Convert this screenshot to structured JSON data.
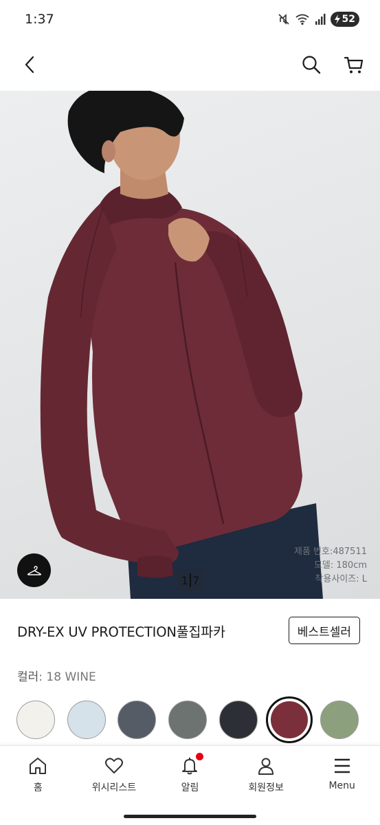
{
  "status": {
    "time": "1:37",
    "battery": "52"
  },
  "header": {
    "back_icon": "chevron-left-icon",
    "search_icon": "search-icon",
    "cart_icon": "cart-icon"
  },
  "hero": {
    "pager_current": "1",
    "pager_total": "7",
    "model_info": [
      {
        "label": "제품 번호",
        "value": "487511"
      },
      {
        "label": "모델",
        "value": "180cm"
      },
      {
        "label": "착용사이즈",
        "value": "L"
      }
    ]
  },
  "product": {
    "title": "DRY-EX UV PROTECTION풀집파카",
    "badge": "베스트셀러",
    "color_label": "컬러",
    "color_value": "18 WINE"
  },
  "swatches": [
    {
      "color": "#f3f1ec",
      "selected": false
    },
    {
      "color": "#d6e2ea",
      "selected": false
    },
    {
      "color": "#555c66",
      "selected": false
    },
    {
      "color": "#6c7370",
      "selected": false
    },
    {
      "color": "#2c2f35",
      "selected": false
    },
    {
      "color": "#7b2f3a",
      "selected": true
    },
    {
      "color": "#8da07e",
      "selected": false
    }
  ],
  "nav": [
    {
      "label": "홈",
      "icon": "home-icon"
    },
    {
      "label": "위시리스트",
      "icon": "heart-icon"
    },
    {
      "label": "알림",
      "icon": "bell-icon",
      "badge": true
    },
    {
      "label": "회원정보",
      "icon": "person-icon"
    },
    {
      "label": "Menu",
      "icon": "menu-icon"
    }
  ],
  "colors": {
    "accent": "#111111",
    "badge_red": "#e60012",
    "jacket": "#6e2c38"
  }
}
